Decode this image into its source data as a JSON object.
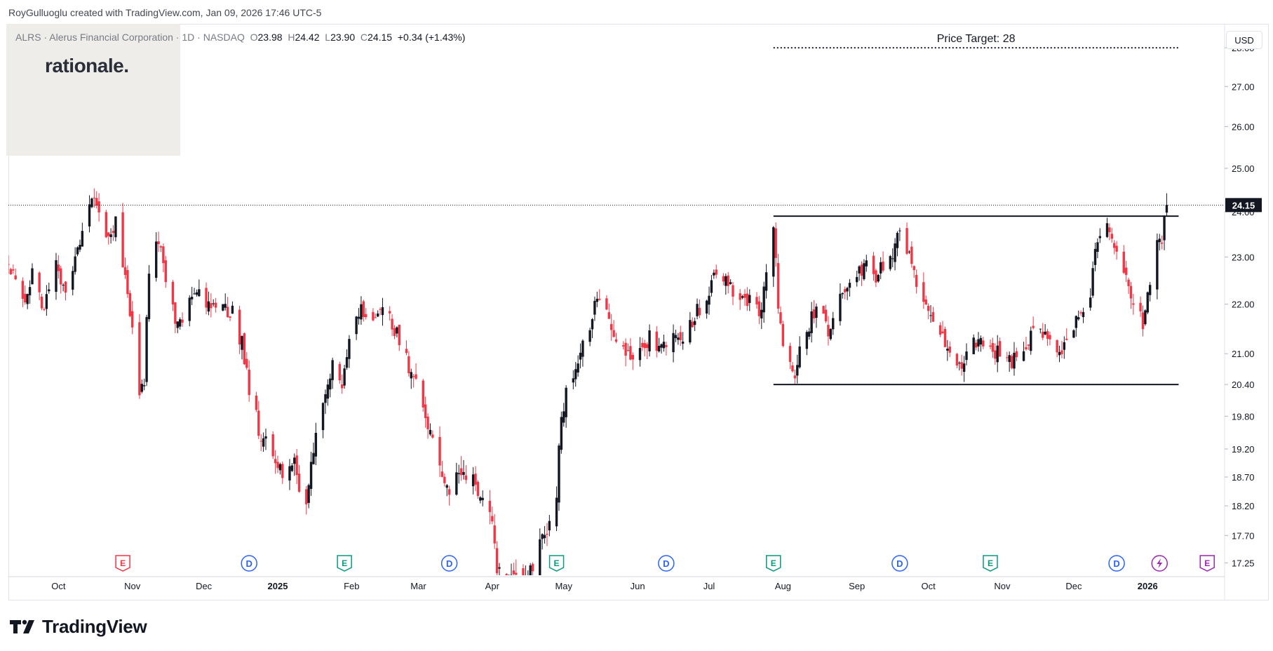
{
  "header": {
    "attribution": "RoyGulluoglu created with TradingView.com, Jan 09, 2026 17:46 UTC-5"
  },
  "legend": {
    "symbol": "ALRS",
    "separator": "·",
    "name": "Alerus Financial Corporation",
    "interval": "1D",
    "exchange": "NASDAQ",
    "open_label": "O",
    "open": "23.98",
    "high_label": "H",
    "high": "24.42",
    "low_label": "L",
    "low": "23.90",
    "close_label": "C",
    "close": "24.15",
    "change": "+0.34 (+1.43%)"
  },
  "watermark": {
    "text": "rationale."
  },
  "currency_button": "USD",
  "footer": {
    "brand": "TradingView"
  },
  "colors": {
    "up": "#131722",
    "down": "#f23645",
    "grid": "#f0f3fa",
    "axis_text": "#131722",
    "dividend": "#2962ff",
    "earnings": "#089981",
    "earnings_future": "#f23645",
    "split": "#9c27b0"
  },
  "chart_data": {
    "type": "candlestick",
    "symbol": "ALRS",
    "interval": "1D",
    "yscale": "log",
    "ylim": [
      17.05,
      28.6
    ],
    "last_price": 24.15,
    "price_ticks": [
      "28.00",
      "27.00",
      "26.00",
      "25.00",
      "24.00",
      "23.00",
      "22.00",
      "21.00",
      "20.40",
      "19.80",
      "19.20",
      "18.70",
      "18.20",
      "17.70",
      "17.25"
    ],
    "time_labels": [
      "Oct",
      "Nov",
      "Dec",
      "2025",
      "Feb",
      "Mar",
      "Apr",
      "May",
      "Jun",
      "Jul",
      "Aug",
      "Sep",
      "Oct",
      "Nov",
      "Dec",
      "2026"
    ],
    "bold_time_labels": [
      "2025",
      "2026"
    ],
    "annotations": [
      {
        "type": "hline_dotted",
        "label": "Price Target: 28",
        "price": 28.0,
        "from": "2025-07-28",
        "to": "2026-01-14"
      },
      {
        "type": "hline",
        "label": "",
        "price": 23.9,
        "from": "2025-07-28",
        "to": "2026-01-14"
      },
      {
        "type": "hline",
        "label": "",
        "price": 20.4,
        "from": "2025-07-28",
        "to": "2026-01-14"
      }
    ],
    "events": [
      {
        "type": "E",
        "date": "2024-10-28"
      },
      {
        "type": "D",
        "date": "2024-12-20"
      },
      {
        "type": "E",
        "date": "2025-01-29"
      },
      {
        "type": "D",
        "date": "2025-03-14"
      },
      {
        "type": "E",
        "date": "2025-04-28"
      },
      {
        "type": "D",
        "date": "2025-06-13"
      },
      {
        "type": "E",
        "date": "2025-07-28"
      },
      {
        "type": "D",
        "date": "2025-09-19"
      },
      {
        "type": "E",
        "date": "2025-10-27"
      },
      {
        "type": "D",
        "date": "2025-12-19"
      },
      {
        "type": "S",
        "date": "2026-01-06"
      },
      {
        "type": "E",
        "date": "2026-01-26"
      }
    ],
    "path": [
      [
        "2024-09-10",
        22.9
      ],
      [
        "2024-09-16",
        22.0
      ],
      [
        "2024-09-20",
        22.6
      ],
      [
        "2024-09-24",
        21.9
      ],
      [
        "2024-09-30",
        22.8
      ],
      [
        "2024-10-04",
        22.2
      ],
      [
        "2024-10-10",
        23.4
      ],
      [
        "2024-10-15",
        24.3
      ],
      [
        "2024-10-18",
        24.1
      ],
      [
        "2024-10-22",
        23.3
      ],
      [
        "2024-10-25",
        23.8
      ],
      [
        "2024-10-29",
        22.5
      ],
      [
        "2024-10-31",
        21.8
      ],
      [
        "2024-11-04",
        20.1
      ],
      [
        "2024-11-06",
        20.5
      ],
      [
        "2024-11-08",
        22.8
      ],
      [
        "2024-11-12",
        23.4
      ],
      [
        "2024-11-15",
        22.4
      ],
      [
        "2024-11-20",
        21.5
      ],
      [
        "2024-11-25",
        22.0
      ],
      [
        "2024-11-29",
        22.3
      ],
      [
        "2024-12-04",
        21.9
      ],
      [
        "2024-12-09",
        22.0
      ],
      [
        "2024-12-13",
        21.8
      ],
      [
        "2024-12-17",
        21.2
      ],
      [
        "2024-12-20",
        20.3
      ],
      [
        "2024-12-24",
        19.6
      ],
      [
        "2024-12-30",
        19.0
      ],
      [
        "2025-01-03",
        18.8
      ],
      [
        "2025-01-08",
        19.0
      ],
      [
        "2025-01-10",
        18.6
      ],
      [
        "2025-01-13",
        18.2
      ],
      [
        "2025-01-15",
        19.1
      ],
      [
        "2025-01-17",
        19.5
      ],
      [
        "2025-01-21",
        20.2
      ],
      [
        "2025-01-24",
        20.7
      ],
      [
        "2025-01-28",
        20.2
      ],
      [
        "2025-01-31",
        21.3
      ],
      [
        "2025-02-05",
        21.9
      ],
      [
        "2025-02-10",
        21.6
      ],
      [
        "2025-02-14",
        21.9
      ],
      [
        "2025-02-19",
        21.5
      ],
      [
        "2025-02-24",
        20.9
      ],
      [
        "2025-02-28",
        20.4
      ],
      [
        "2025-03-04",
        19.9
      ],
      [
        "2025-03-07",
        19.4
      ],
      [
        "2025-03-11",
        18.8
      ],
      [
        "2025-03-14",
        18.5
      ],
      [
        "2025-03-19",
        18.7
      ],
      [
        "2025-03-24",
        18.6
      ],
      [
        "2025-03-28",
        18.4
      ],
      [
        "2025-04-01",
        18.0
      ],
      [
        "2025-04-03",
        17.2
      ],
      [
        "2025-04-08",
        16.9
      ],
      [
        "2025-04-14",
        17.0
      ],
      [
        "2025-04-18",
        17.1
      ],
      [
        "2025-04-22",
        17.7
      ],
      [
        "2025-04-25",
        17.9
      ],
      [
        "2025-04-28",
        18.3
      ],
      [
        "2025-04-30",
        19.9
      ],
      [
        "2025-05-05",
        20.6
      ],
      [
        "2025-05-08",
        21.1
      ],
      [
        "2025-05-12",
        21.6
      ],
      [
        "2025-05-15",
        22.2
      ],
      [
        "2025-05-20",
        21.8
      ],
      [
        "2025-05-23",
        21.1
      ],
      [
        "2025-05-28",
        20.9
      ],
      [
        "2025-06-02",
        21.0
      ],
      [
        "2025-06-06",
        21.3
      ],
      [
        "2025-06-11",
        21.1
      ],
      [
        "2025-06-16",
        21.5
      ],
      [
        "2025-06-20",
        21.2
      ],
      [
        "2025-06-25",
        21.8
      ],
      [
        "2025-06-30",
        22.1
      ],
      [
        "2025-07-03",
        22.8
      ],
      [
        "2025-07-08",
        22.5
      ],
      [
        "2025-07-11",
        22.2
      ],
      [
        "2025-07-15",
        22.0
      ],
      [
        "2025-07-18",
        22.2
      ],
      [
        "2025-07-22",
        21.7
      ],
      [
        "2025-07-25",
        22.6
      ],
      [
        "2025-07-28",
        23.7
      ],
      [
        "2025-07-30",
        22.0
      ],
      [
        "2025-08-01",
        21.3
      ],
      [
        "2025-08-04",
        20.7
      ],
      [
        "2025-08-06",
        20.6
      ],
      [
        "2025-08-08",
        21.1
      ],
      [
        "2025-08-12",
        21.6
      ],
      [
        "2025-08-15",
        22.0
      ],
      [
        "2025-08-20",
        21.4
      ],
      [
        "2025-08-25",
        22.2
      ],
      [
        "2025-08-29",
        22.5
      ],
      [
        "2025-09-04",
        22.8
      ],
      [
        "2025-09-09",
        22.6
      ],
      [
        "2025-09-12",
        22.8
      ],
      [
        "2025-09-16",
        23.1
      ],
      [
        "2025-09-19",
        23.5
      ],
      [
        "2025-09-23",
        23.0
      ],
      [
        "2025-09-26",
        22.5
      ],
      [
        "2025-10-01",
        21.8
      ],
      [
        "2025-10-06",
        21.5
      ],
      [
        "2025-10-10",
        21.0
      ],
      [
        "2025-10-15",
        20.8
      ],
      [
        "2025-10-20",
        21.3
      ],
      [
        "2025-10-24",
        21.2
      ],
      [
        "2025-10-28",
        20.9
      ],
      [
        "2025-10-31",
        21.1
      ],
      [
        "2025-11-05",
        20.8
      ],
      [
        "2025-11-10",
        21.1
      ],
      [
        "2025-11-14",
        21.5
      ],
      [
        "2025-11-19",
        21.3
      ],
      [
        "2025-11-24",
        21.0
      ],
      [
        "2025-11-28",
        21.2
      ],
      [
        "2025-12-03",
        21.7
      ],
      [
        "2025-12-08",
        22.2
      ],
      [
        "2025-12-11",
        23.4
      ],
      [
        "2025-12-15",
        23.6
      ],
      [
        "2025-12-18",
        23.2
      ],
      [
        "2025-12-23",
        22.5
      ],
      [
        "2025-12-26",
        22.0
      ],
      [
        "2025-12-30",
        21.6
      ],
      [
        "2026-01-02",
        22.5
      ],
      [
        "2026-01-05",
        23.3
      ],
      [
        "2026-01-07",
        23.2
      ],
      [
        "2026-01-08",
        23.8
      ],
      [
        "2026-01-09",
        24.15
      ]
    ]
  }
}
